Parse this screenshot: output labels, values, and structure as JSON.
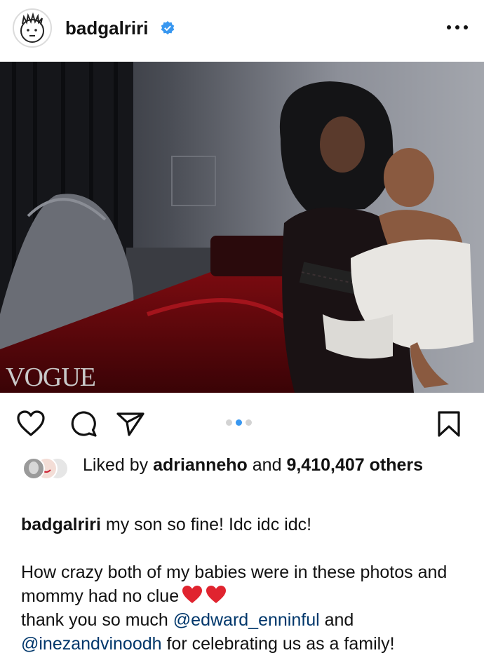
{
  "post": {
    "username": "badgalriri",
    "verified": true,
    "more_icon": "more-horizontal-icon"
  },
  "image": {
    "watermark": "VOGUE",
    "carousel": {
      "count": 3,
      "active_index": 1
    }
  },
  "actions": {
    "like_icon": "heart-icon",
    "comment_icon": "comment-icon",
    "share_icon": "send-icon",
    "save_icon": "bookmark-icon"
  },
  "likes": {
    "prefix": "Liked by",
    "liker": "adrianneho",
    "and": "and",
    "count": "9,410,407",
    "suffix": "others"
  },
  "caption": {
    "username": "badgalriri",
    "line1": "my son so fine! Idc idc idc!",
    "line2": "How crazy both of my babies were in these photos and mommy had no clue",
    "line3_a": "thank you so much",
    "mention1": "@edward_enninful",
    "line3_b": "and",
    "mention2": "@inezandvinoodh",
    "line4": "for celebrating us as a family!"
  },
  "colors": {
    "verified_blue": "#3897f0",
    "mention": "#00376b",
    "heart_red": "#e0242f",
    "active_dot": "#3897f0"
  }
}
